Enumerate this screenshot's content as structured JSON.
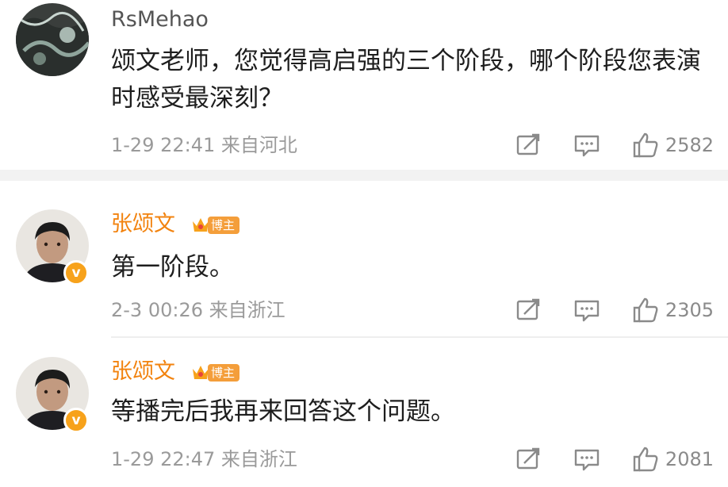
{
  "comments": [
    {
      "username": "RsMehao",
      "text": "颂文老师，您觉得高启强的三个阶段，哪个阶段您表演时感受最深刻？",
      "time": "1-29 22:41",
      "location": "来自河北",
      "likes": "2582",
      "verified": false,
      "host_badge": ""
    },
    {
      "username": "张颂文",
      "text": "第一阶段。",
      "time": "2-3 00:26",
      "location": "来自浙江",
      "likes": "2305",
      "verified": true,
      "verified_mark": "v",
      "host_badge": "博主"
    },
    {
      "username": "张颂文",
      "text": "等播完后我再来回答这个问题。",
      "time": "1-29 22:47",
      "location": "来自浙江",
      "likes": "2081",
      "verified": true,
      "verified_mark": "v",
      "host_badge": "博主"
    }
  ],
  "colors": {
    "vip_name": "#f2830f",
    "badge_bg": "#f49e3a",
    "verified_badge": "#f7a21b",
    "meta_text": "#9a9a9a",
    "divider": "#f2f2f2"
  },
  "icons": [
    "repost-icon",
    "comment-icon",
    "like-icon",
    "crown-icon"
  ]
}
